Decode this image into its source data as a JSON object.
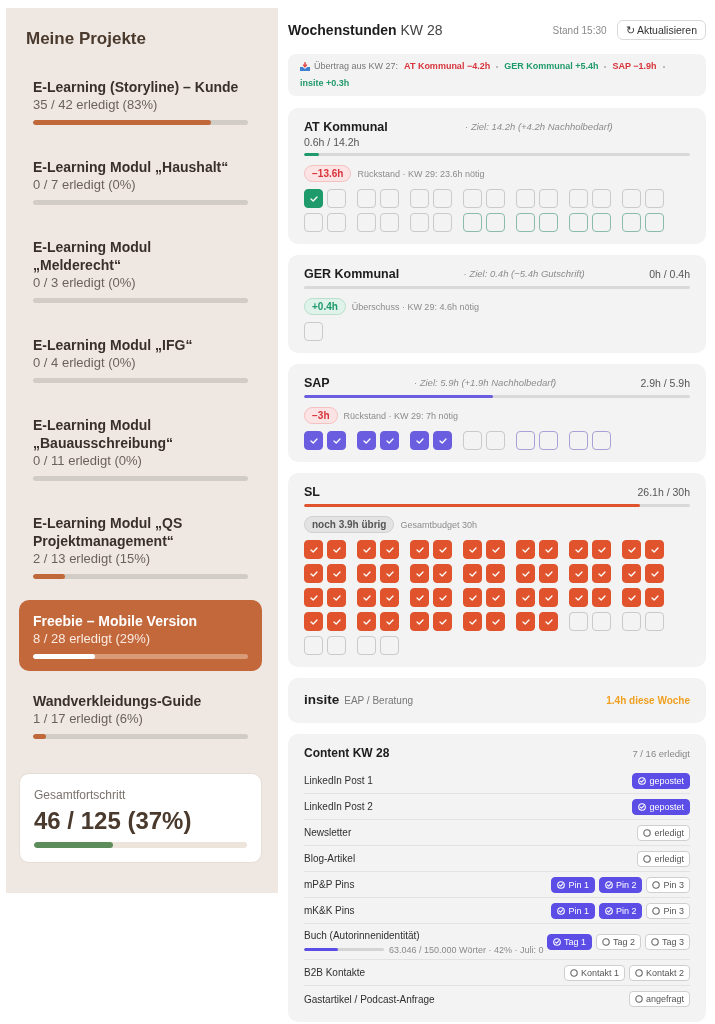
{
  "sidebar": {
    "title": "Meine Projekte",
    "items": [
      {
        "title": "E-Learning (Storyline) – Kunde",
        "progress": "35 / 42 erledigt (83%)",
        "level": 0.83,
        "selected": false
      },
      {
        "title": "E-Learning Modul „Haushalt“",
        "progress": "0 / 7 erledigt (0%)",
        "level": 0,
        "selected": false
      },
      {
        "title": "E-Learning Modul „Melderecht“",
        "progress": "0 / 3 erledigt (0%)",
        "level": 0,
        "selected": false
      },
      {
        "title": "E-Learning Modul „IFG“",
        "progress": "0 / 4 erledigt (0%)",
        "level": 0,
        "selected": false
      },
      {
        "title": "E-Learning Modul „Bauausschreibung“",
        "progress": "0 / 11 erledigt (0%)",
        "level": 0,
        "selected": false
      },
      {
        "title": "E-Learning Modul „QS Projektmanagement“",
        "progress": "2 / 13 erledigt (15%)",
        "level": 0.15,
        "selected": false
      },
      {
        "title": "Freebie – Mobile Version",
        "progress": "8 / 28 erledigt (29%)",
        "level": 0.29,
        "selected": true
      },
      {
        "title": "Wandverkleidungs-Guide",
        "progress": "1 / 17 erledigt (6%)",
        "level": 0.06,
        "selected": false
      }
    ],
    "total": {
      "label": "Gesamtfortschritt",
      "value": "46 / 125 (37%)",
      "level": 0.37
    }
  },
  "week": {
    "title": "**Wochenstunden** KW 28",
    "status": "Stand 15:30",
    "refresh_button": "↻ Aktualisieren"
  },
  "carryover": {
    "label": "Übertrag aus KW 27:",
    "items": [
      {
        "text": "AT Kommunal −4.2h",
        "kind": "deficit"
      },
      {
        "text": "GER Kommunal +5.4h",
        "kind": "surplus"
      },
      {
        "text": "SAP −1.9h",
        "kind": "deficit"
      },
      {
        "text": "insite +0.3h",
        "kind": "surplus"
      }
    ]
  },
  "cards": [
    {
      "kind": "tracker",
      "title": "AT Kommunal",
      "goal": "· Ziel: 14.2h (+4.2h Nachholbedarf)",
      "subtitle": "0.6h / 14.2h",
      "color": "#1f9a6b",
      "level": 0.04,
      "balance": {
        "text": "−13.6h",
        "kind": "deficit"
      },
      "note": "Rückstand · KW 29: 23.6h nötig",
      "slots": [
        {
          "kind": "regular",
          "checked": true
        },
        {
          "kind": "regular",
          "checked": false
        },
        {
          "kind": "regular",
          "checked": false
        },
        {
          "kind": "regular",
          "checked": false
        },
        {
          "kind": "regular",
          "checked": false
        },
        {
          "kind": "regular",
          "checked": false
        },
        {
          "kind": "regular",
          "checked": false
        },
        {
          "kind": "regular",
          "checked": false
        },
        {
          "kind": "regular",
          "checked": false
        },
        {
          "kind": "regular",
          "checked": false
        },
        {
          "kind": "regular",
          "checked": false
        },
        {
          "kind": "regular",
          "checked": false
        },
        {
          "kind": "regular",
          "checked": false
        },
        {
          "kind": "regular",
          "checked": false
        },
        {
          "kind": "regular",
          "checked": false
        },
        {
          "kind": "regular",
          "checked": false
        },
        {
          "kind": "regular",
          "checked": false
        },
        {
          "kind": "regular",
          "checked": false
        },
        {
          "kind": "regular",
          "checked": false
        },
        {
          "kind": "regular",
          "checked": false
        },
        {
          "kind": "catch_up",
          "checked": false
        },
        {
          "kind": "catch_up",
          "checked": false
        },
        {
          "kind": "catch_up",
          "checked": false
        },
        {
          "kind": "catch_up",
          "checked": false
        },
        {
          "kind": "catch_up",
          "checked": false
        },
        {
          "kind": "catch_up",
          "checked": false
        },
        {
          "kind": "catch_up",
          "checked": false
        },
        {
          "kind": "catch_up",
          "checked": false
        }
      ]
    },
    {
      "kind": "tracker",
      "title": "GER Kommunal",
      "goal": "· Ziel: 0.4h (−5.4h Gutschrift)",
      "hours": "0h / 0.4h",
      "level": 0,
      "balance": {
        "text": "+0.4h",
        "kind": "surplus"
      },
      "note": "Überschuss · KW 29: 4.6h nötig",
      "slots": [
        {
          "kind": "regular",
          "checked": false
        }
      ]
    },
    {
      "kind": "tracker",
      "title": "SAP",
      "goal": "· Ziel: 5.9h (+1.9h Nachholbedarf)",
      "hours": "2.9h / 5.9h",
      "color": "#6a5ddf",
      "level": 0.49,
      "balance": {
        "text": "−3h",
        "kind": "deficit"
      },
      "note": "Rückstand · KW 29: 7h nötig",
      "slots": [
        {
          "kind": "regular",
          "checked": true
        },
        {
          "kind": "regular",
          "checked": true
        },
        {
          "kind": "regular",
          "checked": true
        },
        {
          "kind": "regular",
          "checked": true
        },
        {
          "kind": "regular",
          "checked": true
        },
        {
          "kind": "regular",
          "checked": true
        },
        {
          "kind": "regular",
          "checked": false
        },
        {
          "kind": "regular",
          "checked": false
        },
        {
          "kind": "catch_up",
          "checked": false
        },
        {
          "kind": "catch_up",
          "checked": false
        },
        {
          "kind": "catch_up",
          "checked": false
        },
        {
          "kind": "catch_up",
          "checked": false
        }
      ]
    },
    {
      "kind": "tracker",
      "title": "SL",
      "hours": "26.1h / 30h",
      "color": "#e0532c",
      "level": 0.87,
      "balance": {
        "text": "noch 3.9h übrig",
        "kind": "remaining"
      },
      "note": "Gesamtbudget 30h",
      "slots": [
        {
          "kind": "regular",
          "checked": true
        },
        {
          "kind": "regular",
          "checked": true
        },
        {
          "kind": "regular",
          "checked": true
        },
        {
          "kind": "regular",
          "checked": true
        },
        {
          "kind": "regular",
          "checked": true
        },
        {
          "kind": "regular",
          "checked": true
        },
        {
          "kind": "regular",
          "checked": true
        },
        {
          "kind": "regular",
          "checked": true
        },
        {
          "kind": "regular",
          "checked": true
        },
        {
          "kind": "regular",
          "checked": true
        },
        {
          "kind": "regular",
          "checked": true
        },
        {
          "kind": "regular",
          "checked": true
        },
        {
          "kind": "regular",
          "checked": true
        },
        {
          "kind": "regular",
          "checked": true
        },
        {
          "kind": "regular",
          "checked": true
        },
        {
          "kind": "regular",
          "checked": true
        },
        {
          "kind": "regular",
          "checked": true
        },
        {
          "kind": "regular",
          "checked": true
        },
        {
          "kind": "regular",
          "checked": true
        },
        {
          "kind": "regular",
          "checked": true
        },
        {
          "kind": "regular",
          "checked": true
        },
        {
          "kind": "regular",
          "checked": true
        },
        {
          "kind": "regular",
          "checked": true
        },
        {
          "kind": "regular",
          "checked": true
        },
        {
          "kind": "regular",
          "checked": true
        },
        {
          "kind": "regular",
          "checked": true
        },
        {
          "kind": "regular",
          "checked": true
        },
        {
          "kind": "regular",
          "checked": true
        },
        {
          "kind": "regular",
          "checked": true
        },
        {
          "kind": "regular",
          "checked": true
        },
        {
          "kind": "regular",
          "checked": true
        },
        {
          "kind": "regular",
          "checked": true
        },
        {
          "kind": "regular",
          "checked": true
        },
        {
          "kind": "regular",
          "checked": true
        },
        {
          "kind": "regular",
          "checked": true
        },
        {
          "kind": "regular",
          "checked": true
        },
        {
          "kind": "regular",
          "checked": true
        },
        {
          "kind": "regular",
          "checked": true
        },
        {
          "kind": "regular",
          "checked": true
        },
        {
          "kind": "regular",
          "checked": true
        },
        {
          "kind": "regular",
          "checked": true
        },
        {
          "kind": "regular",
          "checked": true
        },
        {
          "kind": "regular",
          "checked": true
        },
        {
          "kind": "regular",
          "checked": true
        },
        {
          "kind": "regular",
          "checked": true
        },
        {
          "kind": "regular",
          "checked": true
        },
        {
          "kind": "regular",
          "checked": true
        },
        {
          "kind": "regular",
          "checked": true
        },
        {
          "kind": "regular",
          "checked": true
        },
        {
          "kind": "regular",
          "checked": true
        },
        {
          "kind": "regular",
          "checked": true
        },
        {
          "kind": "regular",
          "checked": true
        },
        {
          "kind": "regular",
          "checked": false
        },
        {
          "kind": "regular",
          "checked": false
        },
        {
          "kind": "regular",
          "checked": false
        },
        {
          "kind": "regular",
          "checked": false
        },
        {
          "kind": "regular",
          "checked": false
        },
        {
          "kind": "regular",
          "checked": false
        },
        {
          "kind": "regular",
          "checked": false
        },
        {
          "kind": "regular",
          "checked": false
        }
      ]
    },
    {
      "kind": "summary",
      "title": "insite",
      "subtitle": "EAP / Beratung",
      "hours": "1.4h diese Woche",
      "color": "#f0a020"
    }
  ],
  "content": {
    "title": "Content KW 28",
    "count": "7 / 16 erledigt",
    "rows": [
      {
        "label": "LinkedIn Post 1",
        "toggles": [
          {
            "label": "gepostet",
            "done": true
          }
        ]
      },
      {
        "label": "LinkedIn Post 2",
        "toggles": [
          {
            "label": "gepostet",
            "done": true
          }
        ]
      },
      {
        "label": "Newsletter",
        "toggles": [
          {
            "label": "erledigt",
            "done": false
          }
        ]
      },
      {
        "label": "Blog-Artikel",
        "toggles": [
          {
            "label": "erledigt",
            "done": false
          }
        ]
      },
      {
        "label": "mP&P Pins",
        "toggles": [
          {
            "label": "Pin 1",
            "done": true
          },
          {
            "label": "Pin 2",
            "done": true
          },
          {
            "label": "Pin 3",
            "done": false
          }
        ]
      },
      {
        "label": "mK&K Pins",
        "toggles": [
          {
            "label": "Pin 1",
            "done": true
          },
          {
            "label": "Pin 2",
            "done": true
          },
          {
            "label": "Pin 3",
            "done": false
          }
        ]
      },
      {
        "label": "Buch (Autorinnenidentität)",
        "progress": {
          "level": 0.42,
          "text": "63.046 / 150.000 Wörter · 42% · Juli: 0"
        },
        "toggles": [
          {
            "label": "Tag 1",
            "done": true
          },
          {
            "label": "Tag 2",
            "done": false
          },
          {
            "label": "Tag 3",
            "done": false
          }
        ]
      },
      {
        "label": "B2B Kontakte",
        "toggles": [
          {
            "label": "Kontakt 1",
            "done": false
          },
          {
            "label": "Kontakt 2",
            "done": false
          }
        ]
      },
      {
        "label": "Gastartikel / Podcast-Anfrage",
        "toggles": [
          {
            "label": "angefragt",
            "done": false
          }
        ]
      }
    ]
  }
}
